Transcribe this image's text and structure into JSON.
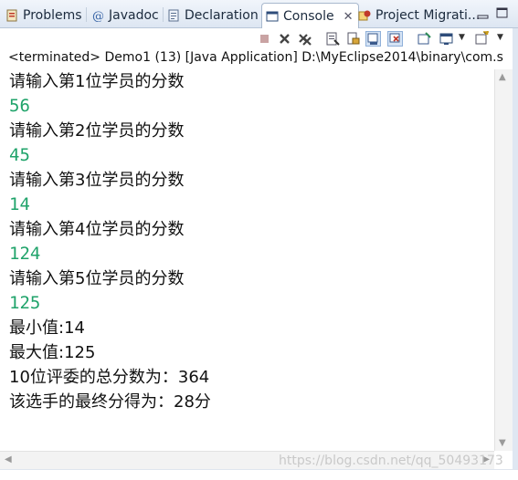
{
  "tabs": [
    {
      "label": "Problems",
      "icon": "problems-icon"
    },
    {
      "label": "Javadoc",
      "icon": "javadoc-icon"
    },
    {
      "label": "Declaration",
      "icon": "declaration-icon"
    },
    {
      "label": "Console",
      "icon": "console-icon",
      "active": true,
      "close": "✕"
    },
    {
      "label": "Project Migrati...",
      "icon": "project-migration-icon"
    }
  ],
  "window_controls": {
    "minimize": "▭",
    "maximize": "▭"
  },
  "toolbar": {
    "icons": [
      "terminate-icon",
      "remove-launch-icon",
      "remove-all-terminated-icon",
      "clear-console-icon",
      "scroll-lock-icon",
      "show-on-stdout-icon",
      "show-on-stderr-icon",
      "pin-console-icon",
      "display-console-icon",
      "open-console-icon"
    ]
  },
  "status": "<terminated> Demo1 (13) [Java Application] D:\\MyEclipse2014\\binary\\com.s",
  "console_lines": [
    {
      "text": "请输入第1位学员的分数",
      "type": "out"
    },
    {
      "text": "56",
      "type": "in"
    },
    {
      "text": "请输入第2位学员的分数",
      "type": "out"
    },
    {
      "text": "45",
      "type": "in"
    },
    {
      "text": "请输入第3位学员的分数",
      "type": "out"
    },
    {
      "text": "14",
      "type": "in"
    },
    {
      "text": "请输入第4位学员的分数",
      "type": "out"
    },
    {
      "text": "124",
      "type": "in"
    },
    {
      "text": "请输入第5位学员的分数",
      "type": "out"
    },
    {
      "text": "125",
      "type": "in"
    },
    {
      "text": "最小值:14",
      "type": "out"
    },
    {
      "text": "最大值:125",
      "type": "out"
    },
    {
      "text": "10位评委的总分数为：364",
      "type": "out"
    },
    {
      "text": "该选手的最终分得为：28分",
      "type": "out"
    }
  ],
  "colors": {
    "input_text": "#1fa36a",
    "output_text": "#111111"
  },
  "watermark": "https://blog.csdn.net/qq_50493173"
}
